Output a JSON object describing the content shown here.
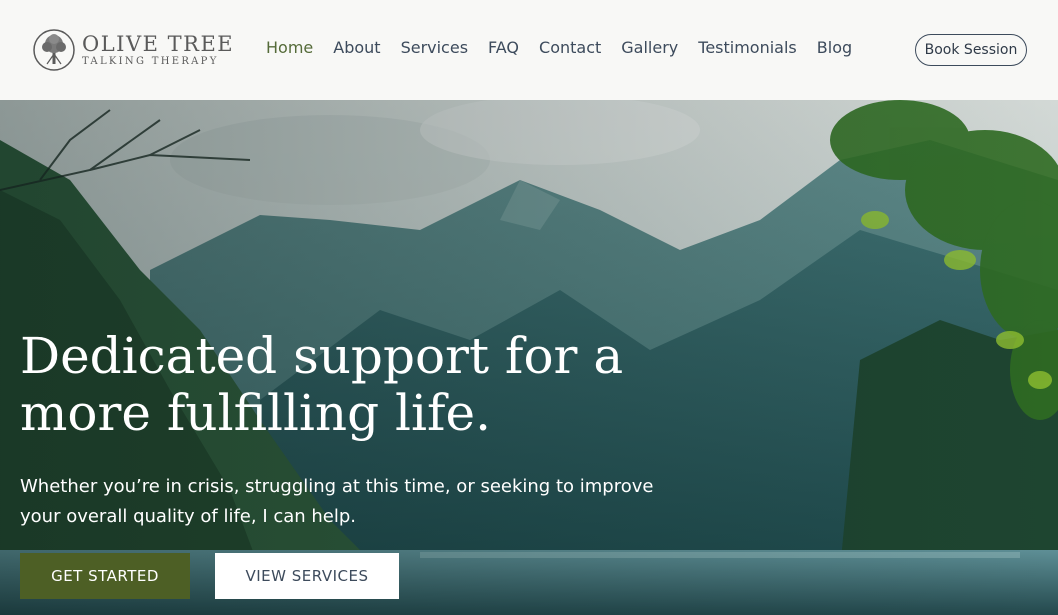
{
  "brand": {
    "name": "OLIVE TREE",
    "tagline": "TALKING THERAPY",
    "logo_icon": "tree-icon"
  },
  "nav": {
    "items": [
      {
        "label": "Home",
        "active": true
      },
      {
        "label": "About",
        "active": false
      },
      {
        "label": "Services",
        "active": false
      },
      {
        "label": "FAQ",
        "active": false
      },
      {
        "label": "Contact",
        "active": false
      },
      {
        "label": "Gallery",
        "active": false
      },
      {
        "label": "Testimonials",
        "active": false
      },
      {
        "label": "Blog",
        "active": false
      }
    ],
    "cta_label": "Book Session"
  },
  "hero": {
    "headline": "Dedicated support for a more fulfilling life.",
    "subtext": "Whether you’re in crisis, struggling at this time, or seeking to improve your overall quality of life, I can help.",
    "primary_button": "GET STARTED",
    "secondary_button": "VIEW SERVICES"
  },
  "colors": {
    "accent_green": "#4d5f25",
    "nav_active": "#556b39",
    "nav_text": "#3d4b5c",
    "header_bg": "#f8f8f6"
  }
}
